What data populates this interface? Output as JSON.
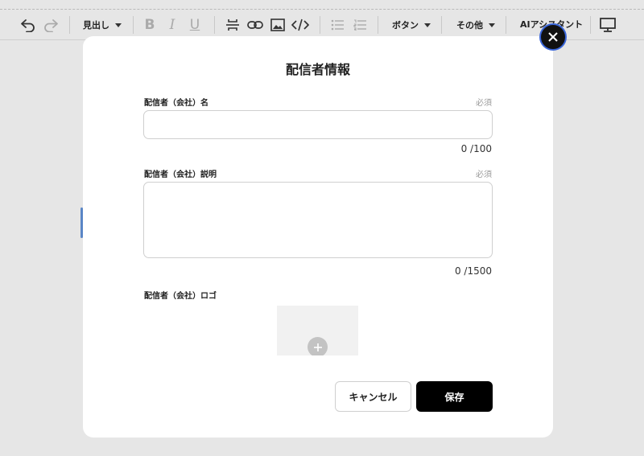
{
  "toolbar": {
    "heading_label": "見出し",
    "bold_glyph": "B",
    "italic_glyph": "I",
    "underline_glyph": "U",
    "button_label": "ボタン",
    "other_label": "その他",
    "ai_label": "AIアシスタント"
  },
  "modal": {
    "title": "配信者情報",
    "name_field": {
      "label": "配信者（会社）名",
      "required": "必須",
      "value": "",
      "counter": "0 /100"
    },
    "description_field": {
      "label": "配信者（会社）説明",
      "required": "必須",
      "value": "",
      "counter": "0 /1500"
    },
    "logo_field": {
      "label": "配信者（会社）ロゴ"
    },
    "cancel_label": "キャンセル",
    "save_label": "保存"
  }
}
